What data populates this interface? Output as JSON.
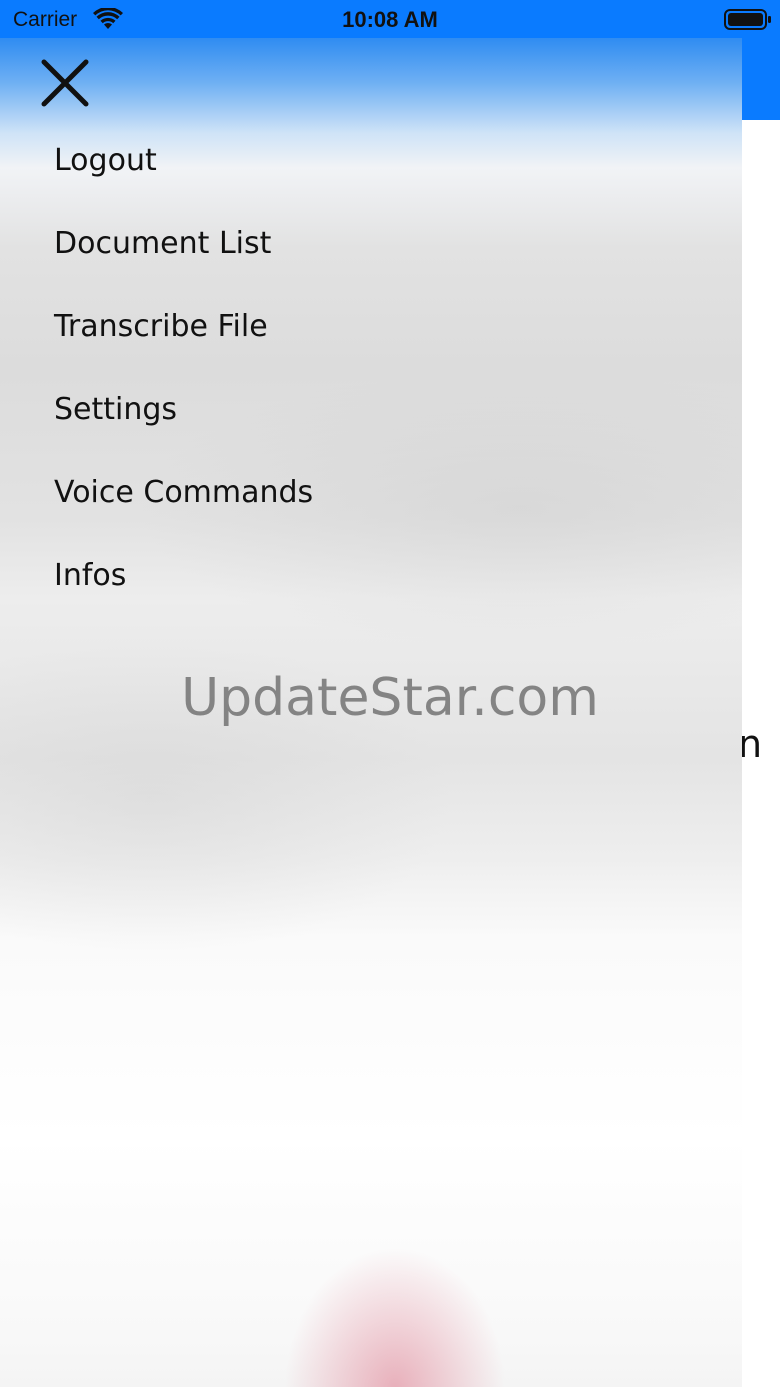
{
  "status_bar": {
    "carrier": "Carrier",
    "time": "10:08 AM",
    "wifi_icon": "wifi-icon",
    "battery_icon": "battery-icon"
  },
  "drawer": {
    "close_icon": "close-icon",
    "items": [
      {
        "label": "Logout"
      },
      {
        "label": "Document List"
      },
      {
        "label": "Transcribe File"
      },
      {
        "label": "Settings"
      },
      {
        "label": "Voice Commands"
      },
      {
        "label": "Infos"
      }
    ]
  },
  "background_app": {
    "peek_text": "n"
  },
  "watermark": "UpdateStar.com",
  "colors": {
    "accent": "#0a7bff",
    "text": "#111111"
  }
}
